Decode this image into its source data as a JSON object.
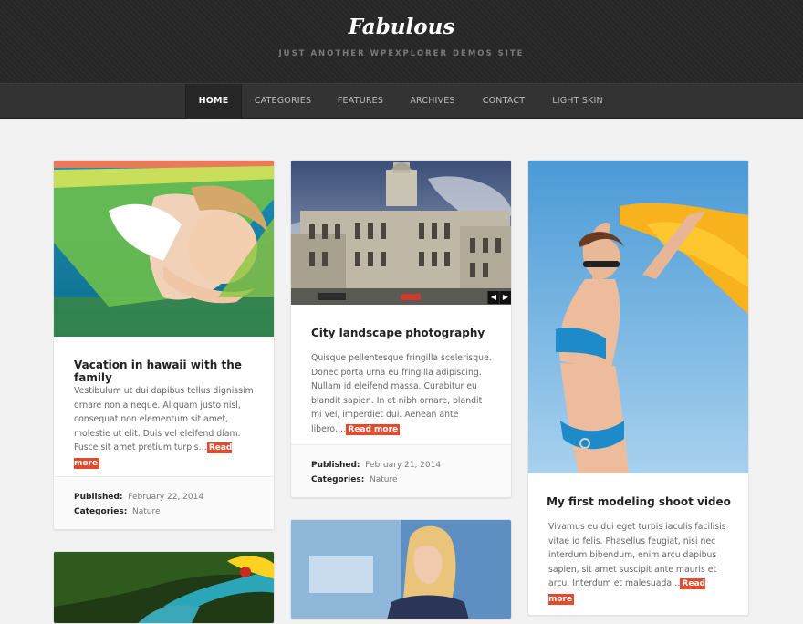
{
  "site": {
    "title": "Fabulous",
    "tagline": "JUST ANOTHER WPEXPLORER DEMOS SITE"
  },
  "nav": [
    {
      "label": "HOME",
      "active": true
    },
    {
      "label": "CATEGORIES",
      "active": false
    },
    {
      "label": "FEATURES",
      "active": false
    },
    {
      "label": "ARCHIVES",
      "active": false
    },
    {
      "label": "CONTACT",
      "active": false
    },
    {
      "label": "LIGHT SKIN",
      "active": false
    }
  ],
  "posts": [
    {
      "title": "Vacation in hawaii with the family",
      "excerpt": "Vestibulum ut dui dapibus tellus dignissim ornare non a neque. Aliquam justo nisl, consequat non elementum sit amet, molestie ut elit. Duis vel eleifend diam. Fusce sit amet pretium turpis…",
      "read_more": "Read more",
      "published_label": "Published:",
      "published": "February 22, 2014",
      "categories_label": "Categories:",
      "category": "Nature"
    },
    {
      "title": "City landscape photography",
      "excerpt": "Quisque pellentesque fringilla scelerisque. Donec porta urna eu fringilla adipiscing. Nullam id eleifend massa. Curabitur eu blandit sapien. In et nibh ornare, blandit mi vel, imperdiet dui. Aenean ante libero,…",
      "read_more": "Read more",
      "published_label": "Published:",
      "published": "February 21, 2014",
      "categories_label": "Categories:",
      "category": "Nature",
      "slider_prev": "◀",
      "slider_next": "▶"
    },
    {
      "title": "My first modeling shoot video",
      "excerpt": "Vivamus eu dui eget turpis iaculis facilisis vitae id felis. Phasellus feugiat, nisi nec interdum bibendum, enim arcu dapibus sapien, sit amet suscipit ante mauris et arcu. Interdum et malesuada…",
      "read_more": "Read more"
    }
  ],
  "colors": {
    "accent": "#e24b2e",
    "header_bg": "#2b2b2b",
    "nav_bg": "#333333",
    "page_bg": "#f2f2f2"
  }
}
